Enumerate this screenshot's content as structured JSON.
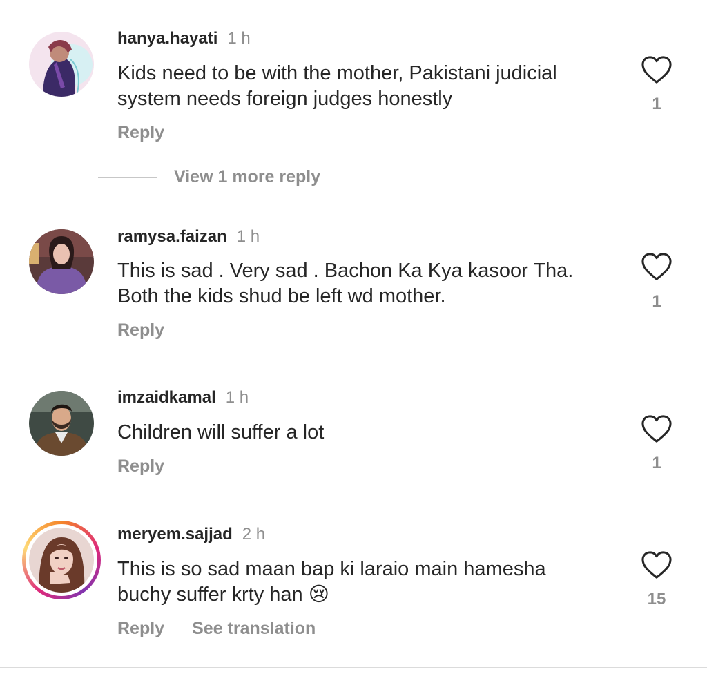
{
  "comments": [
    {
      "username": "hanya.hayati",
      "time": "1 h",
      "text_lines": [
        "Kids need to be with the mother, Pakistani judicial",
        "system needs foreign judges honestly"
      ],
      "reply_label": "Reply",
      "likes": "1"
    },
    {
      "username": "ramysa.faizan",
      "time": "1 h",
      "text_lines": [
        "This is sad . Very sad . Bachon Ka Kya kasoor Tha.",
        "Both the kids shud be left wd mother."
      ],
      "reply_label": "Reply",
      "likes": "1"
    },
    {
      "username": "imzaidkamal",
      "time": "1 h",
      "text_lines": [
        "Children will suffer a lot"
      ],
      "reply_label": "Reply",
      "likes": "1"
    },
    {
      "username": "meryem.sajjad",
      "time": "2 h",
      "text_lines": [
        "This is so sad maan bap ki laraio main hamesha",
        "buchy suffer krty han 😢"
      ],
      "reply_label": "Reply",
      "translate_label": "See translation",
      "likes": "15"
    }
  ],
  "view_more_replies": "View 1 more reply",
  "icons": {
    "like": "heart-outline-icon"
  },
  "colors": {
    "text_primary": "#262626",
    "text_secondary": "#8e8e8e",
    "story_ring_start": "#f58529",
    "story_ring_end": "#dd2a7b"
  }
}
